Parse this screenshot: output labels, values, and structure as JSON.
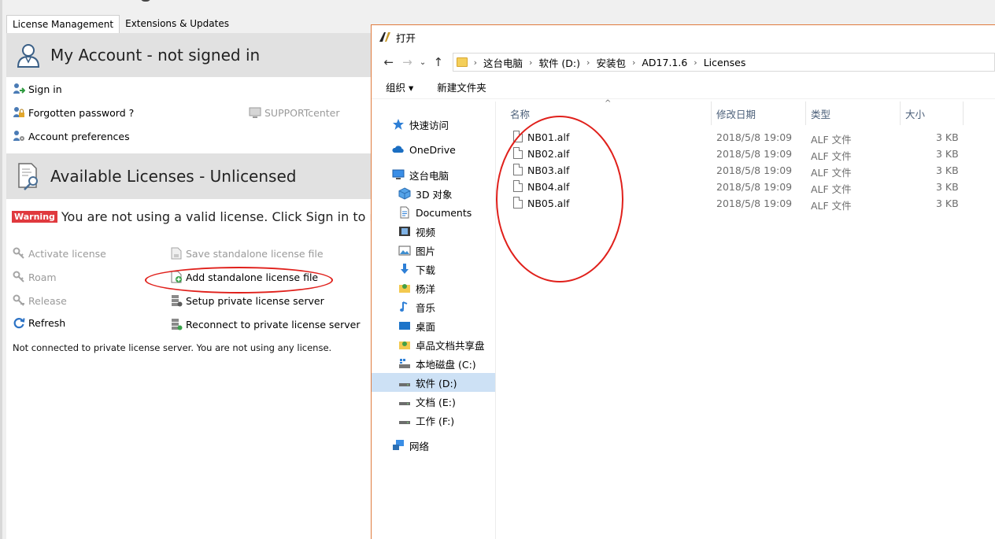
{
  "license_manager": {
    "tabs": [
      {
        "label": "License Management",
        "active": true
      },
      {
        "label": "Extensions & Updates",
        "active": false
      }
    ],
    "account_section": {
      "title": "My Account - not signed in",
      "actions": {
        "sign_in": "Sign in",
        "forgotten_password": "Forgotten password ?",
        "support_center": "SUPPORTcenter",
        "account_preferences": "Account preferences"
      }
    },
    "licenses_section": {
      "title": "Available Licenses - Unlicensed",
      "warning_badge": "Warning",
      "warning_text": "You are not using a valid license. Click Sign in to retri",
      "actions": {
        "activate_license": "Activate license",
        "save_standalone": "Save standalone license file",
        "roam": "Roam",
        "add_standalone": "Add standalone license file",
        "release": "Release",
        "setup_private_server": "Setup private license server",
        "refresh": "Refresh",
        "reconnect_private_server": "Reconnect to private license server"
      },
      "status": "Not connected to private license server. You are not using any license."
    }
  },
  "open_dialog": {
    "title": "打开",
    "breadcrumbs": [
      "这台电脑",
      "软件 (D:)",
      "安装包",
      "AD17.1.6",
      "Licenses"
    ],
    "toolbar": {
      "organize": "组织 ▾",
      "new_folder": "新建文件夹"
    },
    "nav": [
      {
        "label": "快速访问",
        "icon": "star-icon"
      },
      {
        "label": "OneDrive",
        "icon": "cloud-icon"
      },
      {
        "label": "这台电脑",
        "icon": "pc-icon"
      },
      {
        "label": "3D 对象",
        "icon": "cube-icon"
      },
      {
        "label": "Documents",
        "icon": "document-icon"
      },
      {
        "label": "视频",
        "icon": "video-icon"
      },
      {
        "label": "图片",
        "icon": "picture-icon"
      },
      {
        "label": "下载",
        "icon": "download-icon"
      },
      {
        "label": "杨洋",
        "icon": "user-folder-icon"
      },
      {
        "label": "音乐",
        "icon": "music-icon"
      },
      {
        "label": "桌面",
        "icon": "desktop-icon"
      },
      {
        "label": "卓品文档共享盘",
        "icon": "share-folder-icon"
      },
      {
        "label": "本地磁盘 (C:)",
        "icon": "system-drive-icon"
      },
      {
        "label": "软件 (D:)",
        "icon": "drive-icon",
        "selected": true
      },
      {
        "label": "文档 (E:)",
        "icon": "drive-icon"
      },
      {
        "label": "工作 (F:)",
        "icon": "drive-icon"
      },
      {
        "label": "网络",
        "icon": "network-icon"
      }
    ],
    "columns": {
      "name": "名称",
      "date": "修改日期",
      "type": "类型",
      "size": "大小"
    },
    "files": [
      {
        "name": "NB01.alf",
        "date": "2018/5/8 19:09",
        "type": "ALF 文件",
        "size": "3 KB"
      },
      {
        "name": "NB02.alf",
        "date": "2018/5/8 19:09",
        "type": "ALF 文件",
        "size": "3 KB"
      },
      {
        "name": "NB03.alf",
        "date": "2018/5/8 19:09",
        "type": "ALF 文件",
        "size": "3 KB"
      },
      {
        "name": "NB04.alf",
        "date": "2018/5/8 19:09",
        "type": "ALF 文件",
        "size": "3 KB"
      },
      {
        "name": "NB05.alf",
        "date": "2018/5/8 19:09",
        "type": "ALF 文件",
        "size": "3 KB"
      }
    ]
  },
  "colors": {
    "accent_red": "#e0201b",
    "selection": "#cde1f5",
    "header_gray": "#e1e1e1"
  }
}
